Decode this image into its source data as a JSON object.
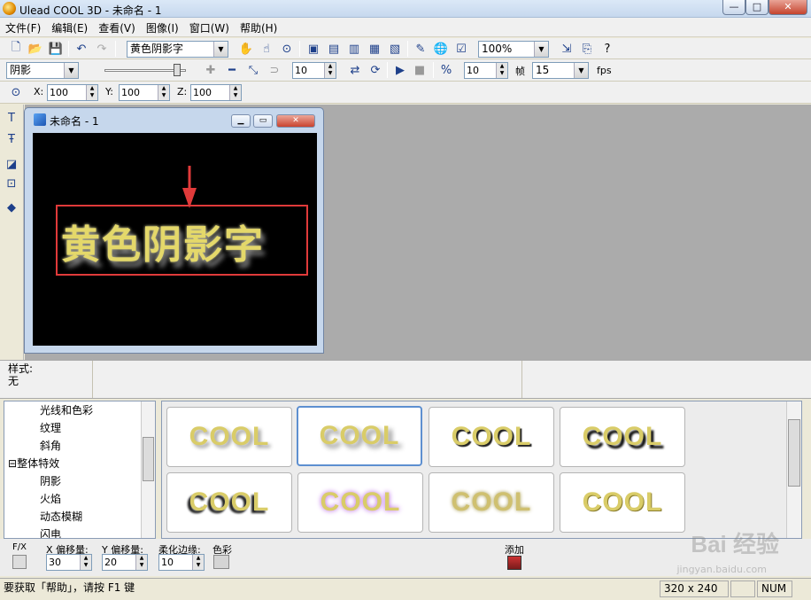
{
  "app": {
    "title": "Ulead COOL 3D - 未命名 - 1",
    "window_buttons": [
      "—",
      "□",
      "✕"
    ]
  },
  "menu": [
    "文件(F)",
    "编辑(E)",
    "查看(V)",
    "图像(I)",
    "窗口(W)",
    "帮助(H)"
  ],
  "toolbar1": {
    "text_combo": "黄色阴影字",
    "zoom_combo": "100%"
  },
  "toolbar2": {
    "effect_combo": "阴影",
    "frame_value": "10",
    "frames_value": "10",
    "frame_label": "帧",
    "fps_combo": "15",
    "fps_label": "fps"
  },
  "toolbar3": {
    "x_label": "X:",
    "x_value": "100",
    "y_label": "Y:",
    "y_value": "100",
    "z_label": "Z:",
    "z_value": "100"
  },
  "document": {
    "title": "未命名 - 1",
    "canvas_text": "黄色阴影字",
    "arrow_color": "#e03a3a",
    "text_color": "#e4d86a"
  },
  "style_panel": {
    "label": "样式:",
    "value": "无"
  },
  "tree": {
    "items": [
      {
        "label": "光线和色彩",
        "indent": 2
      },
      {
        "label": "纹理",
        "indent": 2
      },
      {
        "label": "斜角",
        "indent": 2
      },
      {
        "label": "整体特效",
        "indent": 0,
        "expand": "⊟"
      },
      {
        "label": "阴影",
        "indent": 2
      },
      {
        "label": "火焰",
        "indent": 2
      },
      {
        "label": "动态模糊",
        "indent": 2
      },
      {
        "label": "闪电",
        "indent": 2
      }
    ]
  },
  "thumbnails": [
    {
      "label": "COOL",
      "style": "soft-shadow"
    },
    {
      "label": "COOL",
      "style": "blur-shadow",
      "selected": true
    },
    {
      "label": "COOL",
      "style": "dark-shadow"
    },
    {
      "label": "COOL",
      "style": "drop-shadow"
    },
    {
      "label": "COOL",
      "style": "offset-shadow"
    },
    {
      "label": "COOL",
      "style": "purple-glow"
    },
    {
      "label": "COOL",
      "style": "blur"
    },
    {
      "label": "COOL",
      "style": "outline"
    }
  ],
  "params": {
    "fx_label": "F/X",
    "x_offset_label": "X 偏移量:",
    "x_offset_value": "30",
    "y_offset_label": "Y 偏移量:",
    "y_offset_value": "20",
    "soft_edge_label": "柔化边缘:",
    "soft_edge_value": "10",
    "color_label": "色彩",
    "add_label": "添加"
  },
  "status": {
    "help_text": "要获取「帮助」，请按 F1 键",
    "size": "320 x 240",
    "num": "NUM"
  },
  "watermark": {
    "brand": "Bai 经验",
    "url": "jingyan.baidu.com"
  }
}
